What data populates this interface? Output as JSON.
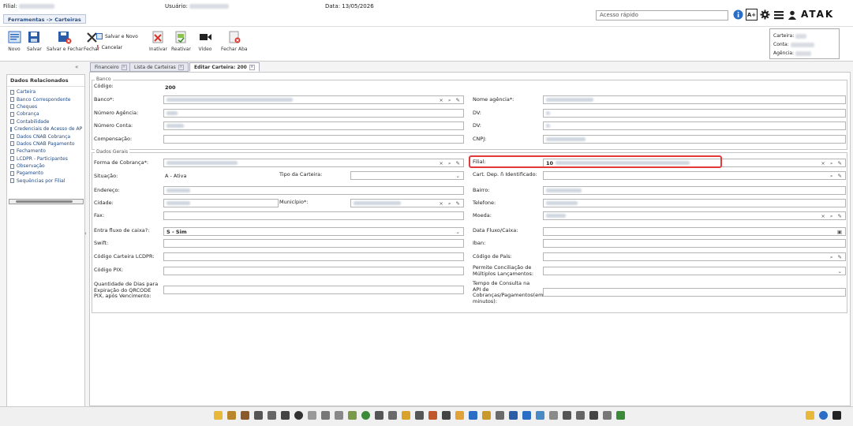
{
  "header": {
    "filial_label": "Filial:",
    "usuario_label": "Usuário:",
    "data_label": "Data: 13/05/2026",
    "breadcrumb": "Ferramentas -> Carteiras",
    "quick_access_placeholder": "Acesso rápido",
    "a_plus": "A+",
    "logo": "ATAK"
  },
  "toolbar": {
    "buttons": [
      {
        "label": "Novo"
      },
      {
        "label": "Salvar"
      },
      {
        "label": "Salvar e Fechar"
      },
      {
        "label": "Fechar"
      },
      {
        "label": "Salvar e Novo"
      },
      {
        "label": "Cancelar"
      },
      {
        "label": "Inativar"
      },
      {
        "label": "Reativar"
      },
      {
        "label": "Vídeo"
      },
      {
        "label": "Fechar Aba"
      }
    ]
  },
  "info_box": {
    "carteira_label": "Carteira:",
    "conta_label": "Conta:",
    "agencia_label": "Agência:"
  },
  "left_panel": {
    "title": "Dados Relacionados",
    "items": [
      "Carteira",
      "Banco Correspondente",
      "Cheques",
      "Cobrança",
      "Contabilidade",
      "Credenciais de Acesso de AP",
      "Dados CNAB Cobrança",
      "Dados CNAB Pagamento",
      "Fechamento",
      "LCDPR - Participantes",
      "Observação",
      "Pagamento",
      "Sequências por Filial"
    ]
  },
  "tabs": [
    {
      "label": "Financeiro"
    },
    {
      "label": "Lista de Carteiras"
    },
    {
      "label": "Editar Carteira: 200"
    }
  ],
  "form": {
    "banco_section": {
      "legend": "Banco",
      "codigo_label": "Código:",
      "codigo_value": "200",
      "banco_label": "Banco*:",
      "nome_agencia_label": "Nome agência*:",
      "numero_agencia_label": "Número Agência:",
      "dv_agencia_label": "DV:",
      "numero_conta_label": "Número Conta:",
      "dv_conta_label": "DV:",
      "compensacao_label": "Compensação:",
      "cnpj_label": "CNPJ:"
    },
    "dados_gerais": {
      "legend": "Dados Gerais",
      "forma_cobranca_label": "Forma de Cobrança*:",
      "filial_label": "Filial:",
      "filial_value_prefix": "10",
      "situacao_label": "Situação:",
      "situacao_value": "A - Ativa",
      "tipo_carteira_label": "Tipo da Carteira:",
      "cart_dep_label": "Cart. Dep. ñ Identificado:",
      "endereco_label": "Endereço:",
      "bairro_label": "Bairro:",
      "cidade_label": "Cidade:",
      "municipio_label": "Município*:",
      "telefone_label": "Telefone:",
      "fax_label": "Fax:",
      "moeda_label": "Moeda:",
      "entra_fluxo_label": "Entra fluxo de caixa?:",
      "entra_fluxo_value": "S - Sim",
      "data_fluxo_label": "Data Fluxo/Caixa:",
      "swift_label": "Swift:",
      "iban_label": "Iban:",
      "codigo_lcdpr_label": "Código Carteira LCDPR:",
      "codigo_pais_label": "Código de País:",
      "codigo_pix_label": "Código PIX:",
      "permite_conciliacao_label": "Permite Conciliação de Múltiplos Lançamentos:",
      "qtd_dias_label": "Quantidade de Dias para Expiração do QRCODE PIX, após Vencimento:",
      "tempo_consulta_label": "Tempo de Consulta na API de Cobranças/Pagamentos(em minutos):"
    }
  },
  "colors": {
    "highlight": "#e23a3a",
    "link": "#1f4a88",
    "accent": "#2b6cc4"
  }
}
